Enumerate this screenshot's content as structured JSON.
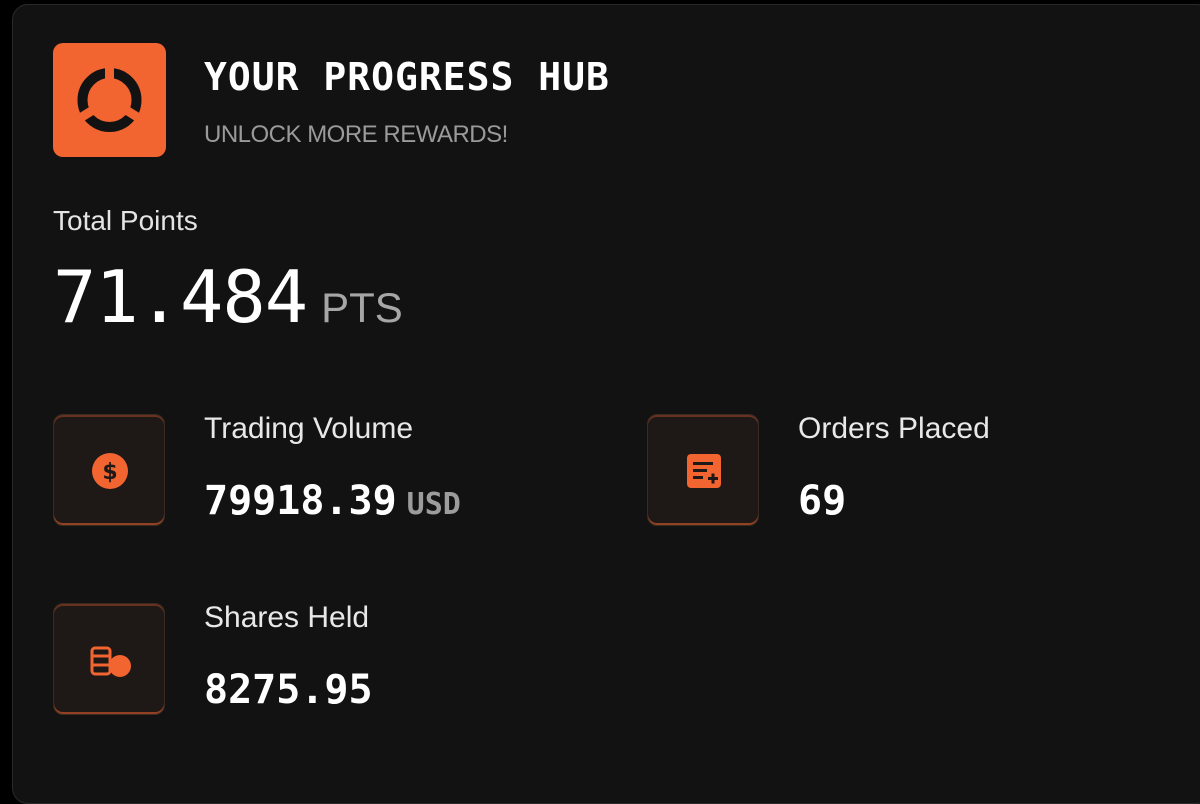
{
  "header": {
    "title": "YOUR PROGRESS HUB",
    "subtitle": "UNLOCK MORE REWARDS!",
    "logo_icon": "target-ring-icon"
  },
  "total": {
    "label": "Total Points",
    "value": "71.484",
    "unit": "PTS"
  },
  "stats": {
    "trading_volume": {
      "label": "Trading Volume",
      "value": "79918.39",
      "unit": "USD",
      "icon": "dollar-coin-icon"
    },
    "orders_placed": {
      "label": "Orders Placed",
      "value": "69",
      "icon": "order-list-icon"
    },
    "shares_held": {
      "label": "Shares Held",
      "value": "8275.95",
      "icon": "coin-stack-icon"
    }
  },
  "colors": {
    "accent": "#f26430",
    "background": "#121212",
    "text": "#ffffff",
    "muted": "#9a9a9a"
  }
}
